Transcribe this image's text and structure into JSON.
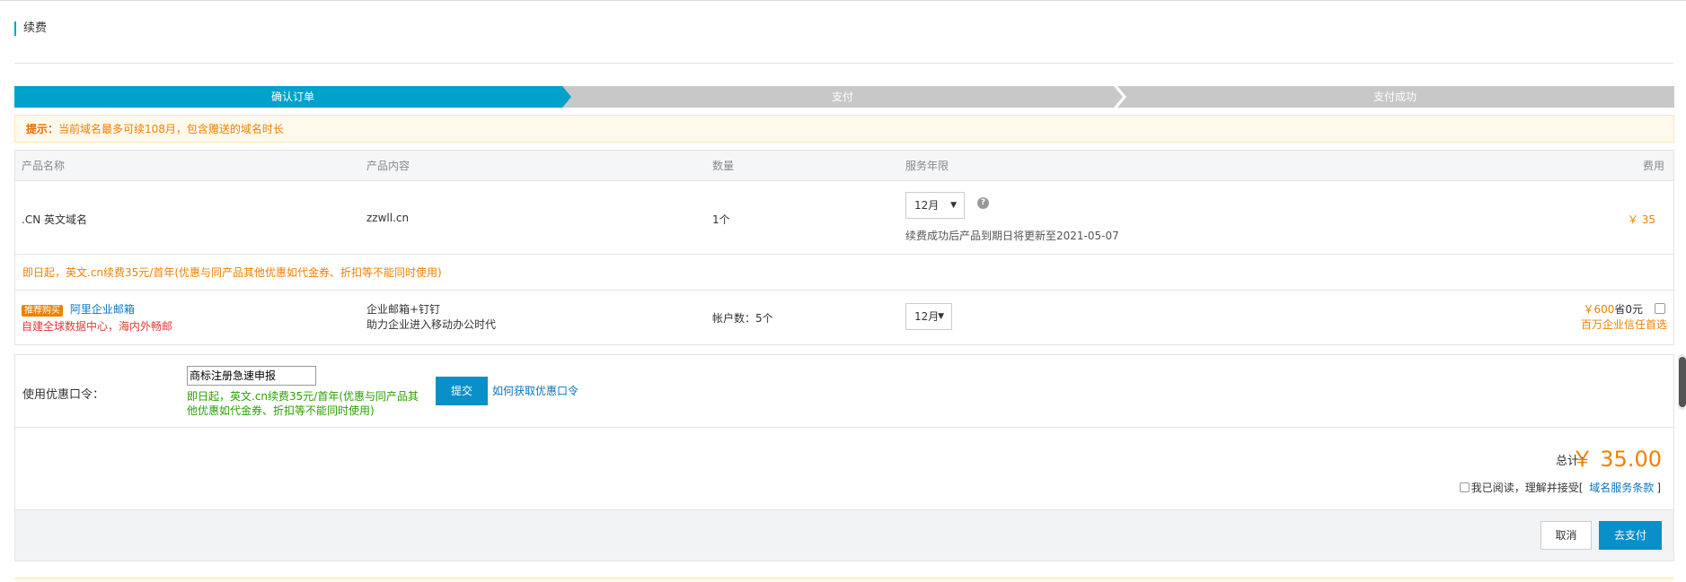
{
  "page": {
    "title": "续费"
  },
  "steps": [
    {
      "label": "确认订单",
      "active": true
    },
    {
      "label": "支付",
      "active": false
    },
    {
      "label": "支付成功",
      "active": false
    }
  ],
  "tip": {
    "prefix": "提示：",
    "text": "当前域名最多可续108月，包含赠送的域名时长"
  },
  "table": {
    "headers": {
      "name": "产品名称",
      "content": "产品内容",
      "qty": "数量",
      "period": "服务年限",
      "fee": "费用"
    },
    "domain_row": {
      "name": ".CN 英文域名",
      "content": "zzwll.cn",
      "qty": "1个",
      "period": "12月",
      "help_icon": "question-circle-icon",
      "expiry_note": "续费成功后产品到期日将更新至2021-05-07",
      "fee": "￥ 35"
    },
    "promo_note": "即日起，英文.cn续费35元/首年(优惠与同产品其他优惠如代金券、折扣等不能同时使用)",
    "mail_row": {
      "badge": "推荐购买",
      "name": "阿里企业邮箱",
      "slogan": "自建全球数据中心，海内外畅邮",
      "content_line1": "企业邮箱+钉钉",
      "content_line2": "助力企业进入移动办公时代",
      "qty": "帐户数：5个",
      "period": "12月",
      "price": "￥600",
      "save": "省0元",
      "trust": "百万企业信任首选"
    }
  },
  "coupon": {
    "label": "使用优惠口令：",
    "input_value": "商标注册急速申报",
    "note": "即日起，英文.cn续费35元/首年(优惠与同产品其他优惠如代金券、折扣等不能同时使用)",
    "submit_label": "提交",
    "howto_link": "如何获取优惠口令"
  },
  "total": {
    "label": "总计：",
    "value": "￥ 35.00",
    "agree_text": "我已阅读，理解并接受[",
    "agree_link": "域名服务条款",
    "agree_end": "]"
  },
  "actions": {
    "cancel_label": "取消",
    "pay_label": "去支付"
  },
  "colors": {
    "accent": "#00a2ca",
    "orange": "#f08000",
    "link": "#0a75c2",
    "green": "#2aa000"
  }
}
